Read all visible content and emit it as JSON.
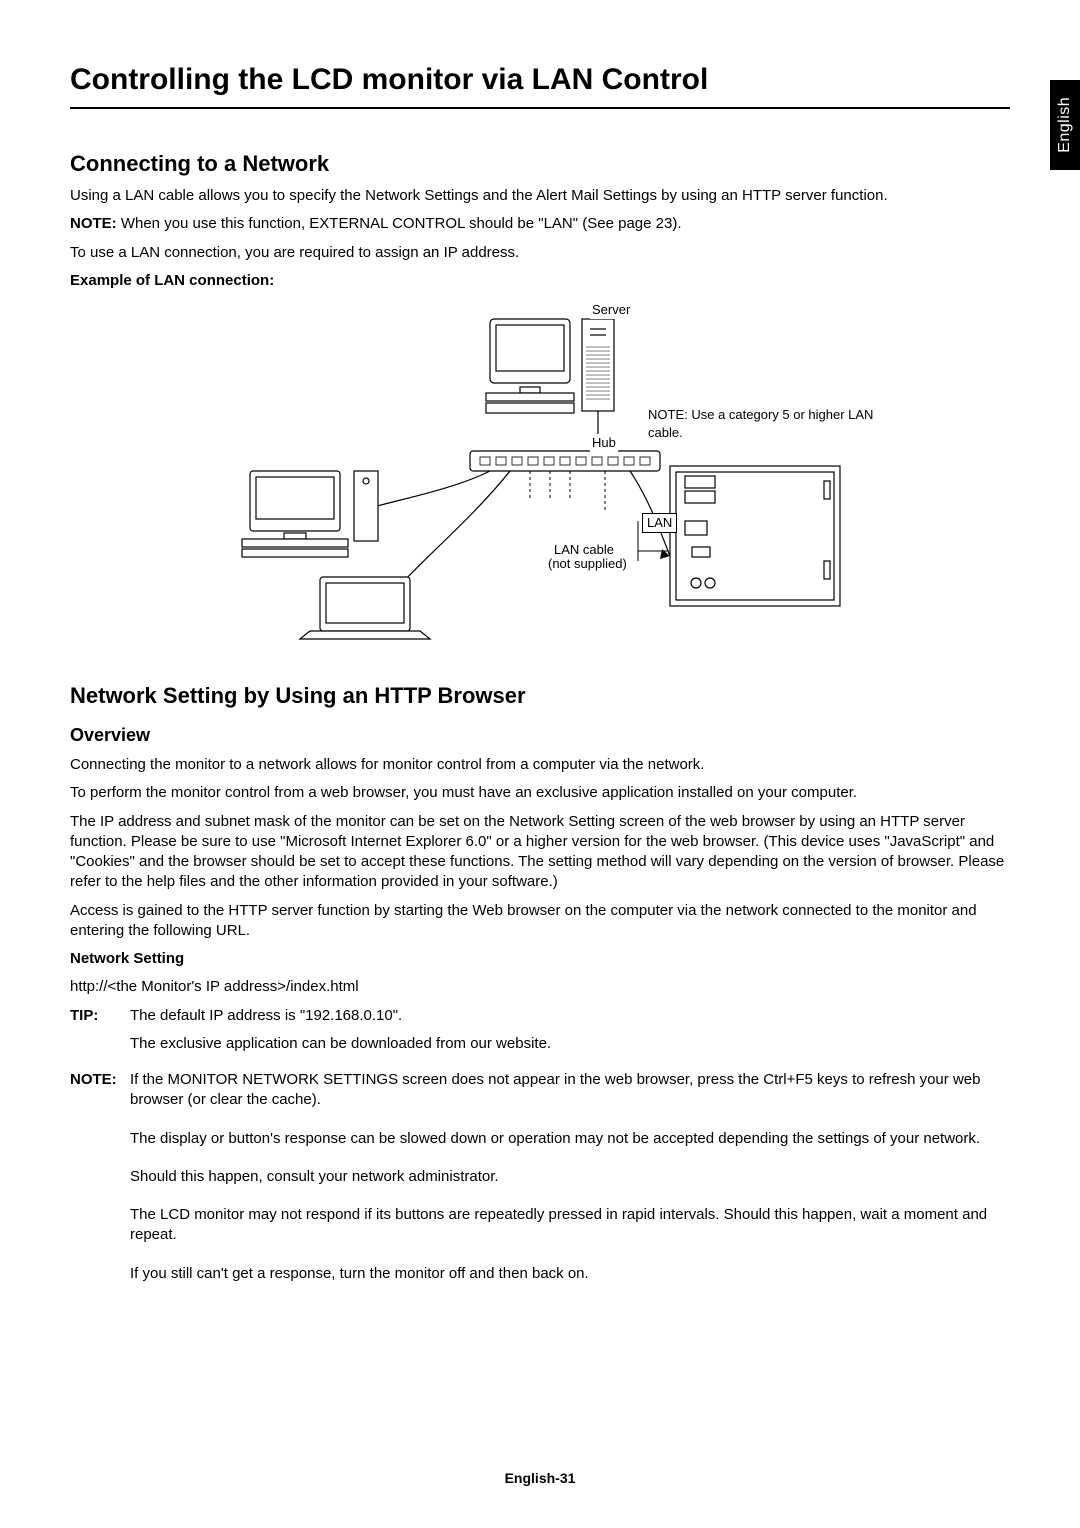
{
  "side_tab": "English",
  "title": "Controlling the LCD monitor via LAN Control",
  "section1": {
    "heading": "Connecting to a Network",
    "p1": "Using a LAN cable allows you to specify the Network Settings and the Alert Mail Settings by using an HTTP server function.",
    "note_label": "NOTE:",
    "note_text": "When you use this function, EXTERNAL CONTROL should be \"LAN\" (See page 23).",
    "p2": "To use a LAN connection, you are required to assign an IP address.",
    "example_label": "Example of LAN connection:"
  },
  "diagram": {
    "server": "Server",
    "hub": "Hub",
    "lan": "LAN",
    "lan_cable": "LAN cable",
    "not_supplied": "(not supplied)",
    "note": "NOTE: Use a category 5 or higher LAN cable."
  },
  "section2": {
    "heading": "Network Setting by Using an HTTP Browser",
    "overview": "Overview",
    "p1": "Connecting the monitor to a network allows for monitor control from a computer via the network.",
    "p2": "To perform the monitor control from a web browser, you must have an exclusive application installed on your computer.",
    "p3": "The IP address and subnet mask of the monitor can be set on the Network Setting screen of the web browser by using an HTTP server function. Please be sure to use \"Microsoft Internet Explorer 6.0\" or a higher version for the web browser. (This device uses \"JavaScript\" and \"Cookies\" and the browser should be set to accept these functions. The setting method will vary depending on the version of browser. Please refer to the help files and the other information provided in your software.)",
    "p4": "Access is gained to the HTTP server function by starting the Web browser on the computer via the network connected to the monitor and entering the following URL.",
    "net_setting_label": "Network Setting",
    "url": "http://<the Monitor's IP address>/index.html",
    "tip_label": "TIP:",
    "tip_line1": "The default IP address is \"192.168.0.10\".",
    "tip_line2": "The exclusive application can be downloaded from our website.",
    "note_label": "NOTE:",
    "note_p1": "If the MONITOR NETWORK SETTINGS screen does not appear in the web browser, press the Ctrl+F5 keys to refresh your web browser (or clear the cache).",
    "note_p2": "The display or button's response can be slowed down or operation may not be accepted depending the settings of your network.",
    "note_p3": "Should this happen, consult your network administrator.",
    "note_p4": "The LCD monitor may not respond if its buttons are repeatedly pressed in rapid intervals. Should this happen, wait a moment and repeat.",
    "note_p5": "If you still can't get a response, turn the monitor off and then back on."
  },
  "footer": "English-31"
}
